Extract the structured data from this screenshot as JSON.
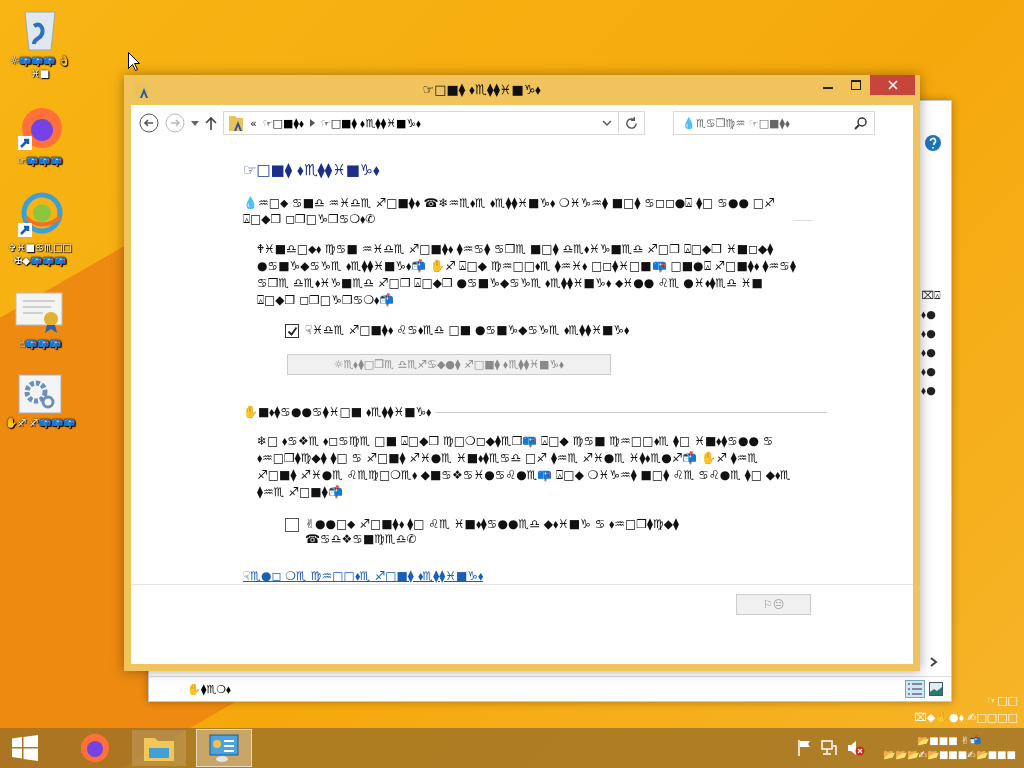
{
  "desktop_icons": [
    {
      "kind": "recycle-bin",
      "label": "☼📪📪📪 👌♓■"
    },
    {
      "kind": "firefox",
      "label": "☞📪📪📪"
    },
    {
      "kind": "browser",
      "label": "✞♓■♋♏□□ ✠◆📪📪📪"
    },
    {
      "kind": "certificate",
      "label": "☝📪📪📪"
    },
    {
      "kind": "settings",
      "label": "✋♐ ♐📪📪📪"
    }
  ],
  "back_window": {
    "row_fragments": [
      "⌧⍓",
      "⬧●",
      "⬧●",
      "⬧●",
      "⬧●",
      "⬧●"
    ],
    "status_text": "✋⧫♏❍⬧"
  },
  "dialog": {
    "title": "☞□■⧫ ⬧♏⧫⧫♓■♑⬧",
    "address": {
      "prefix": "«",
      "crumbs": [
        "☞□■⧫⬧",
        "☞□■⧫ ⬧♏⧫⧫♓■♑⬧"
      ]
    },
    "search": {
      "placeholder": "💧♏♋❒♍♒ ☞□■⧫⬧"
    },
    "heading": "☞□■⧫ ⬧♏⧫⧫♓■♑⬧",
    "intro": "💧♒□⬥ ♋■♎ ♒♓♎♏ ♐□■⧫⬧ ☎❄♒♏⬧♏ ⬧♏⧫⧫♓■♑⬧ ❍♓♑♒⧫ ■□⧫ ♋◻◻●⍓ ⧫□ ♋●● □♐ ⍓□◆❒ ◻❒□♑❒♋❍⬧✆",
    "language_section": {
      "text": "🕈♓■♎□⬥⬧ ♍♋■ ♒♓♎♏ ♐□■⧫⬧ ⧫♒♋⧫ ♋❒♏ ■□⧫ ♎♏⬧♓♑■♏♎ ♐□❒ ⍓□◆❒ ♓■◻◆⧫ ●♋■♑◆♋♑♏ ⬧♏⧫⧫♓■♑⬧📬 ✋♐ ⍓□◆ ♍♒□□⬧♏ ⧫♒♓⬧ □◻⧫♓□■📪 □■●⍓ ♐□■⧫⬧ ⧫♒♋⧫ ♋❒♏ ♎♏⬧♓♑■♏♎ ♐□❒ ⍓□◆❒ ●♋■♑◆♋♑♏ ⬧♏⧫⧫♓■♑⬧ ⬥♓●● ♌♏ ●♓⬧⧫♏♎ ♓■ ⍓□◆❒ ◻❒□♑❒♋❍⬧📬",
      "checkbox": {
        "label": "☟♓♎♏ ♐□■⧫⬧ ♌♋⬧♏♎ □■ ●♋■♑◆♋♑♏ ⬧♏⧫⧫♓■♑⬧",
        "checked": true
      },
      "button": {
        "label": "☼♏⬧⧫□❒♏ ♎♏♐♋◆●⧫ ♐□■⧫ ⬧♏⧫⧫♓■♑⬧",
        "disabled": true
      }
    },
    "install_section": {
      "title": "✋■⬧⧫♋●●♋⧫♓□■ ⬧♏⧫⧫♓■♑⬧",
      "text": "❄□ ⬧♋❖♏ ⬧◻♋♍♏ □■ ⍓□◆❒ ♍□❍◻◆⧫♏❒📪 ⍓□◆ ♍♋■ ♍♒□□⬧♏ ⧫□ ♓■⬧⧫♋●● ♋ ⬧♒□❒⧫♍◆⧫ ⧫□ ♋ ♐□■⧫ ♐♓●♏ ♓■⬧⧫♏♋♎ □♐ ⧫♒♏ ♐♓●♏ ♓⧫⬧♏●♐📬 ✋♐ ⧫♒♏ ♐□■⧫ ♐♓●♏ ♌♏♍□❍♏⬧ ◆■♋❖♋♓●♋♌●♏📪 ⍓□◆ ❍♓♑♒⧫ ■□⧫ ♌♏ ♋♌●♏ ⧫□ ◆⬧♏ ⧫♒♏ ♐□■⧫📬",
      "checkbox": {
        "label": "✌●●□⬥ ♐□■⧫⬧ ⧫□ ♌♏ ♓■⬧⧫♋●●♏♎ ◆⬧♓■♑ ♋ ⬧♒□❒⧫♍◆⧫ ☎♋♎❖♋■♍♏♎✆",
        "checked": false
      }
    },
    "link": "☟♏●◻ ❍♏ ♍♒□□⬧♏ ♐□■⧫ ⬧♏⧫⧫♓■♑⬧",
    "ok_button": {
      "label": "⚐😐",
      "disabled": true
    }
  },
  "desktop_notice": [
    "☞□□",
    "⌧◆✋●⬧ ✍□□□□"
  ],
  "taskbar": {
    "apps": [
      {
        "kind": "firefox",
        "active": false
      },
      {
        "kind": "file-explorer",
        "active": false
      },
      {
        "kind": "control-panel",
        "active": true
      }
    ],
    "time": "📂■■■ ✌📬",
    "date": "📂📂📂✍📂■■■✍📂■■■"
  }
}
